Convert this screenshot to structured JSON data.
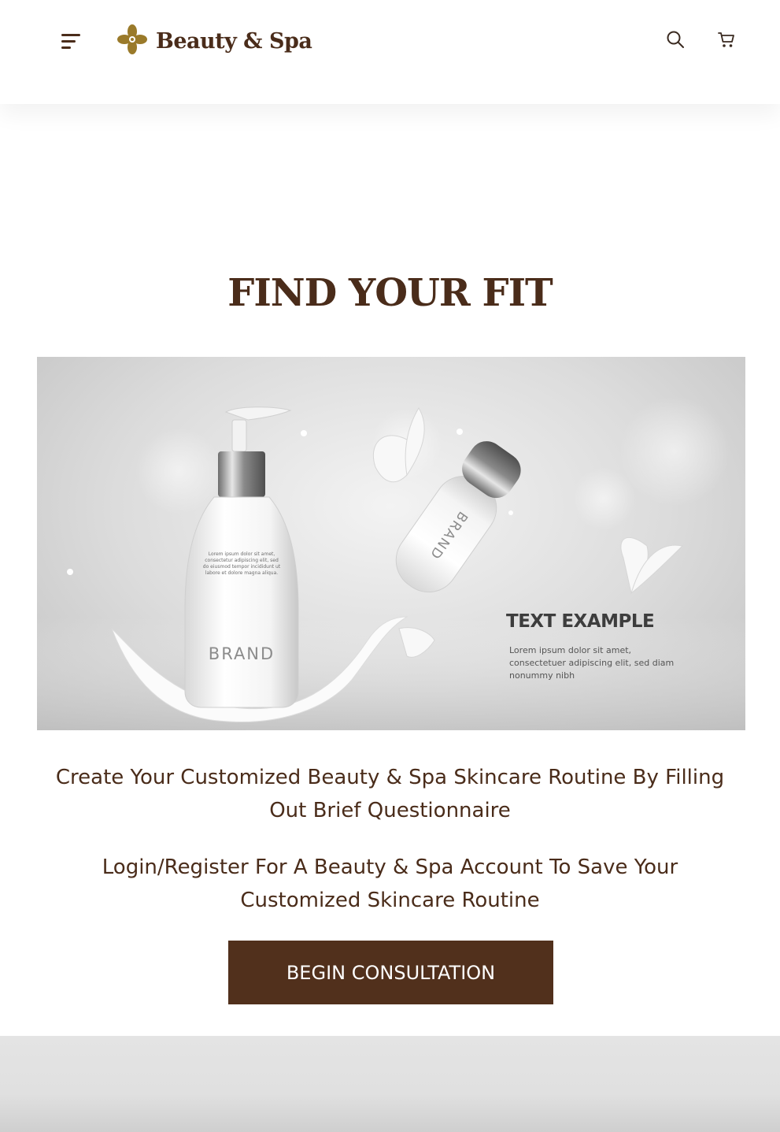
{
  "header": {
    "brand": "Beauty & Spa",
    "icons": {
      "menu": "menu-icon",
      "logo": "flower-logo-icon",
      "search": "search-icon",
      "cart": "cart-icon"
    }
  },
  "main": {
    "title": "FIND YOUR FIT",
    "hero": {
      "bottle_brand": "BRAND",
      "tube_brand": "BRAND",
      "bottle_small_text": [
        "Lorem ipsum dolor sit amet,",
        "consectetur adipiscing elit, sed",
        "do eiusmod tempor incididunt ut",
        "labore et dolore magna aliqua."
      ],
      "ad_headline": "TEXT EXAMPLE",
      "ad_body": [
        "Lorem ipsum dolor sit amet,",
        "consectetuer adipiscing elit, sed diam",
        "nonummy nibh"
      ]
    },
    "description_1": "Create Your Customized Beauty & Spa Skincare Routine By Filling Out Brief Questionnaire",
    "description_2": "Login/Register For A Beauty & Spa Account To Save Your Customized Skincare Routine",
    "cta_label": "BEGIN CONSULTATION"
  },
  "colors": {
    "brand_brown": "#4a2c1a",
    "button_brown": "#51301c",
    "logo_gold": "#9a7a2a"
  }
}
